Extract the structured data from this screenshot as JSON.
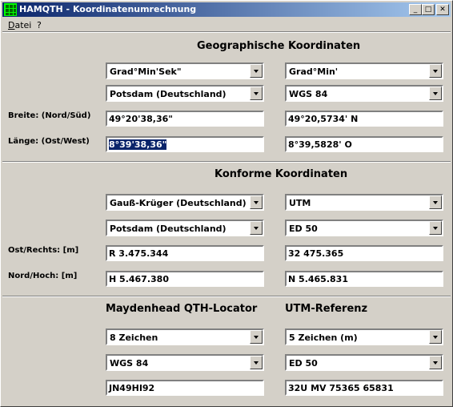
{
  "window": {
    "title": "HAMQTH - Koordinatenumrechnung",
    "minimize": "_",
    "maximize": "□",
    "close": "✕"
  },
  "menu": {
    "datei_u": "D",
    "datei_rest": "atei",
    "help": "?"
  },
  "geo": {
    "title": "Geographische Koordinaten",
    "left_format": "Grad°Min'Sek\"",
    "right_format": "Grad°Min'",
    "left_datum": "Potsdam (Deutschland)",
    "right_datum": "WGS 84",
    "breite_label": "Breite: (Nord/Süd)",
    "laenge_label": "Länge: (Ost/West)",
    "breite_left": "49°20'38,36\"",
    "breite_right": "49°20,5734' N",
    "laenge_left": "8°39'38,36\"",
    "laenge_right": "8°39,5828' O"
  },
  "konform": {
    "title": "Konforme Koordinaten",
    "left_system": "Gauß-Krüger (Deutschland)",
    "right_system": "UTM",
    "left_datum": "Potsdam (Deutschland)",
    "right_datum": "ED 50",
    "ost_label": "Ost/Rechts: [m]",
    "nord_label": "Nord/Hoch: [m]",
    "ost_left": "R 3.475.344",
    "ost_right": "32  475.365",
    "nord_left": "H 5.467.380",
    "nord_right": "N 5.465.831"
  },
  "locator": {
    "title": "Maydenhead QTH-Locator",
    "chars": "8 Zeichen",
    "datum": "WGS 84",
    "value": "JN49HI92"
  },
  "utmref": {
    "title": "UTM-Referenz",
    "chars": "5 Zeichen (m)",
    "datum": "ED 50",
    "value": "32U MV 75365 65831"
  }
}
